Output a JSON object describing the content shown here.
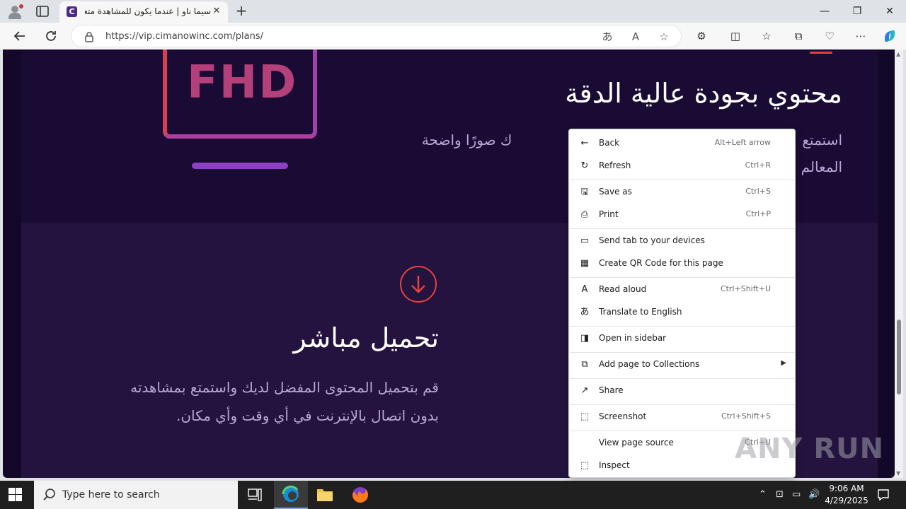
{
  "browser": {
    "tab": {
      "favicon_letter": "C",
      "title": "سيما ناو | عندما يكون للمشاهدة متعة"
    },
    "new_tab": "+",
    "window_controls": {
      "minimize": "—",
      "maximize": "❐",
      "close": "✕"
    },
    "address": "https://vip.cimanowinc.com/plans/",
    "icons": [
      "profile-icon",
      "tab-actions-icon",
      "back-icon",
      "refresh-icon",
      "lock-icon",
      "translate-icon",
      "read-aloud-icon",
      "favorite-icon",
      "extensions-icon",
      "split-screen-icon",
      "favorites-icon",
      "collections-icon",
      "browser-essentials-icon",
      "more-icon",
      "copilot-icon"
    ]
  },
  "page": {
    "badge": "FHD",
    "quality_heading": "محتوي بجودة عالية الدقة",
    "quality_text_line1_right": "استمتع",
    "quality_text_line1_left": "ك صورًا واضحة",
    "quality_text_line2": "المعالم",
    "download_heading": "تحميل مباشر",
    "download_text_line1": "قم بتحميل المحتوى المفضل لديك واستمتع بمشاهدته",
    "download_text_line2": "بدون اتصال بالإنترنت في أي وقت وأي مكان."
  },
  "context_menu": {
    "items": [
      {
        "label": "Back",
        "shortcut": "Alt+Left arrow",
        "icon": "back-arrow-icon"
      },
      {
        "label": "Refresh",
        "shortcut": "Ctrl+R",
        "icon": "refresh-icon"
      },
      {
        "label": "Save as",
        "shortcut": "Ctrl+S",
        "icon": "save-icon"
      },
      {
        "label": "Print",
        "shortcut": "Ctrl+P",
        "icon": "print-icon"
      },
      {
        "label": "Send tab to your devices",
        "shortcut": "",
        "icon": "devices-icon"
      },
      {
        "label": "Create QR Code for this page",
        "shortcut": "",
        "icon": "qr-code-icon"
      },
      {
        "label": "Read aloud",
        "shortcut": "Ctrl+Shift+U",
        "icon": "read-aloud-icon"
      },
      {
        "label": "Translate to English",
        "shortcut": "",
        "icon": "translate-icon"
      },
      {
        "label": "Open in sidebar",
        "shortcut": "",
        "icon": "sidebar-icon"
      },
      {
        "label": "Add page to Collections",
        "shortcut": "",
        "icon": "collections-icon",
        "submenu": true
      },
      {
        "label": "Share",
        "shortcut": "",
        "icon": "share-icon"
      },
      {
        "label": "Screenshot",
        "shortcut": "Ctrl+Shift+S",
        "icon": "screenshot-icon"
      },
      {
        "label": "View page source",
        "shortcut": "Ctrl+U",
        "icon": ""
      },
      {
        "label": "Inspect",
        "shortcut": "",
        "icon": "inspect-icon"
      }
    ]
  },
  "watermark": "ANY RUN",
  "taskbar": {
    "search_placeholder": "Type here to search",
    "time": "9:06 AM",
    "date": "4/29/2025"
  }
}
